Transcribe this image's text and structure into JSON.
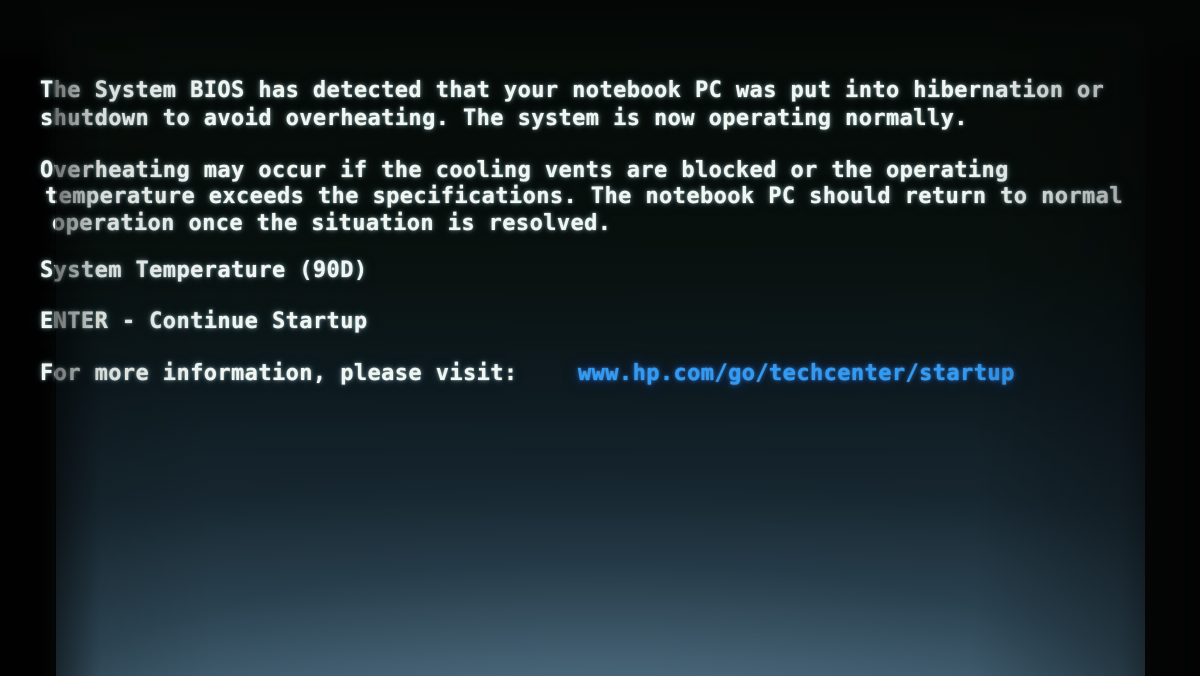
{
  "screen": {
    "kind": "bios-thermal-notice",
    "vendor_hint": "HP System BIOS",
    "background_top_color": "#050a07",
    "background_bottom_color": "#33505f",
    "text_color": "#f2f7f4",
    "link_color": "#2f9bf5"
  },
  "message": {
    "paragraph1": {
      "line1": "The System BIOS has detected that your notebook PC was put into hibernation or",
      "line2": "shutdown to avoid overheating. The system is now operating normally."
    },
    "paragraph2": {
      "line1": "Overheating may occur if the cooling vents are blocked or the operating",
      "line2": "temperature exceeds the specifications. The notebook PC should return to normal",
      "line3": "operation once the situation is resolved."
    },
    "temperature": {
      "label": "System Temperature",
      "value": "(90D)",
      "full_line": "System Temperature (90D)"
    },
    "prompt": {
      "key": "ENTER",
      "separator": "-",
      "action": "Continue Startup",
      "full_line": "ENTER - Continue Startup"
    },
    "more_info": {
      "label": "For more information, please visit:",
      "url": "www.hp.com/go/techcenter/startup"
    }
  }
}
